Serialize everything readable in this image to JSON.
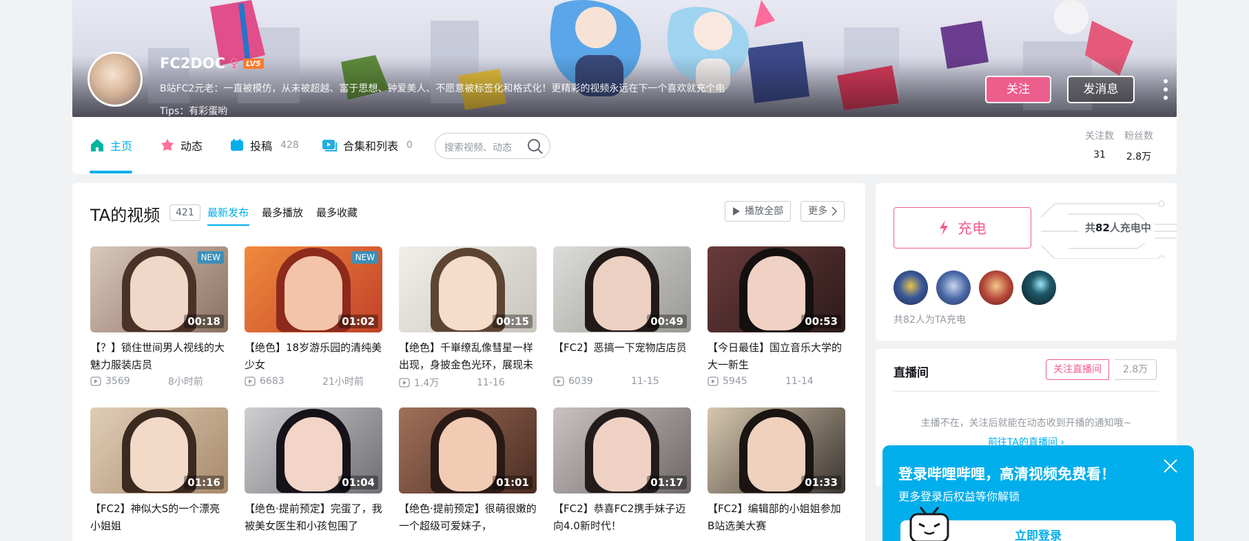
{
  "profile": {
    "username": "FC2DOC",
    "gender_symbol": "♀",
    "level": "LV5",
    "signature": "B站FC2元老：一直被模仿，从未被超越、富于思想、钟爱美人、不愿意被标签化和格式化！更精彩的视频永远在下一个喜欢就充个电",
    "tips": "Tips：有彩蛋哟",
    "follow_label": "关注",
    "message_label": "发消息"
  },
  "nav": {
    "home": "主页",
    "dynamic": "动态",
    "uploads": "投稿",
    "uploads_count": "428",
    "collections": "合集和列表",
    "collections_count": "0",
    "search_placeholder": "搜索视频、动态",
    "following_label": "关注数",
    "following_value": "31",
    "fans_label": "粉丝数",
    "fans_value": "2.8万"
  },
  "videos": {
    "section_title": "TA的视频",
    "total": "421",
    "tabs": [
      "最新发布",
      "最多播放",
      "最多收藏"
    ],
    "play_all": "播放全部",
    "more": "更多",
    "items": [
      {
        "title": "【？】锁住世间男人视线的大魅力服装店员",
        "duration": "00:18",
        "views": "3569",
        "date": "8小时前",
        "new": "NEW"
      },
      {
        "title": "【绝色】18岁游乐园的清纯美少女",
        "duration": "01:02",
        "views": "6683",
        "date": "21小时前",
        "new": "NEW"
      },
      {
        "title": "【绝色】千崋缭乱像彗星一样出现，身披金色光环，展现未",
        "duration": "00:15",
        "views": "1.4万",
        "date": "11-16",
        "new": ""
      },
      {
        "title": "【FC2】恶搞一下宠物店店员",
        "duration": "00:49",
        "views": "6039",
        "date": "11-15",
        "new": ""
      },
      {
        "title": "【今日最佳】国立音乐大学的大一新生",
        "duration": "00:53",
        "views": "5945",
        "date": "11-14",
        "new": ""
      },
      {
        "title": "【FC2】神似大S的一个漂亮小姐姐",
        "duration": "01:16",
        "views": "",
        "date": "",
        "new": ""
      },
      {
        "title": "【绝色·提前预定】完蛋了，我被美女医生和小孩包围了",
        "duration": "01:04",
        "views": "",
        "date": "",
        "new": ""
      },
      {
        "title": "【绝色·提前预定】很萌很嫩的一个超级可爱妹子，",
        "duration": "01:01",
        "views": "",
        "date": "",
        "new": ""
      },
      {
        "title": "【FC2】恭喜FC2携手妹子迈向4.0新时代！",
        "duration": "01:17",
        "views": "",
        "date": "",
        "new": ""
      },
      {
        "title": "【FC2】编辑部的小姐姐参加B站选美大赛",
        "duration": "01:33",
        "views": "",
        "date": "",
        "new": ""
      }
    ]
  },
  "charge": {
    "button_label": "充电",
    "count_prefix": "共",
    "count_value": "82",
    "count_suffix": "人充电中",
    "footer": "共82人为TA充电"
  },
  "live": {
    "title": "直播间",
    "follow_label": "关注直播间",
    "fans": "2.8万",
    "message": "主播不在，关注后就能在动态收到开播的通知哦~",
    "link": "前往TA的直播间"
  },
  "login_popup": {
    "title": "登录哔哩哔哩，高清视频免费看！",
    "subtitle": "更多登录后权益等你解锁",
    "button": "立即登录"
  },
  "colors": {
    "accent": "#00aeec",
    "pink": "#f25d8e",
    "follow_button": "#ec5e8c"
  }
}
